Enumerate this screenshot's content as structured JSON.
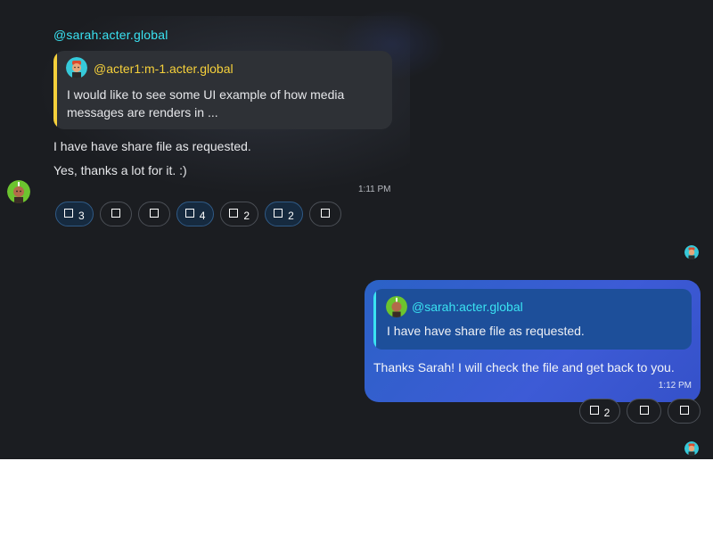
{
  "incoming": {
    "sender": "@sarah:acter.global",
    "reply": {
      "author": "@acter1:m-1.acter.global",
      "text": "I would like to see some UI example of how media messages are renders in ..."
    },
    "messages": [
      "I have have share file as requested.",
      "Yes, thanks a lot for it. :)"
    ],
    "time": "1:11 PM",
    "reactions": [
      {
        "count": "3",
        "active": true
      },
      {
        "count": "",
        "active": false
      },
      {
        "count": "",
        "active": false
      },
      {
        "count": "4",
        "active": true
      },
      {
        "count": "2",
        "active": false
      },
      {
        "count": "2",
        "active": true
      },
      {
        "count": "",
        "active": false
      }
    ]
  },
  "outgoing": {
    "reply": {
      "author": "@sarah:acter.global",
      "text": "I have have share file as requested."
    },
    "text": "Thanks Sarah! I will check the file and get back to you.",
    "time": "1:12 PM",
    "reactions": [
      {
        "count": "2",
        "active": false
      },
      {
        "count": "",
        "active": false
      },
      {
        "count": "",
        "active": false
      }
    ]
  },
  "colors": {
    "background": "#1b1d21",
    "sender_name": "#3ae3f2",
    "quote_author": "#f5d03b",
    "bubble_outgoing": "#3d5bd6"
  },
  "icons": {
    "reaction": "emoji-placeholder-icon",
    "avatar_sarah": "avatar-green",
    "avatar_acter1": "avatar-cyan"
  }
}
